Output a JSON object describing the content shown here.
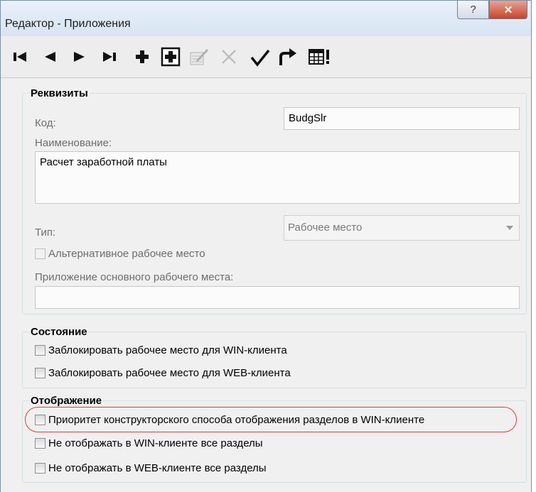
{
  "window": {
    "title": "Редактор - Приложения",
    "help_label": "?",
    "close_label": "✕"
  },
  "toolbar": {
    "items": [
      {
        "name": "first-record-icon",
        "glyph": "⏮"
      },
      {
        "name": "prev-record-icon",
        "glyph": "◀"
      },
      {
        "name": "next-record-icon",
        "glyph": "▶"
      },
      {
        "name": "last-record-icon",
        "glyph": "⏭"
      },
      {
        "name": "add-icon",
        "glyph": "✚"
      },
      {
        "name": "add-boxed-icon",
        "glyph": "⊞"
      },
      {
        "name": "edit-icon",
        "glyph": "✎"
      },
      {
        "name": "delete-icon",
        "glyph": "✕"
      },
      {
        "name": "confirm-icon",
        "glyph": "✓"
      },
      {
        "name": "refresh-icon",
        "glyph": "↪"
      },
      {
        "name": "grid-icon",
        "glyph": "▦!"
      }
    ]
  },
  "requisites": {
    "title": "Реквизиты",
    "code_label": "Код:",
    "code_value": "BudgSlr",
    "name_label": "Наименование:",
    "name_value": "Расчет заработной платы",
    "type_label": "Тип:",
    "type_value": "Рабочее место",
    "alt_workplace_label": "Альтернативное рабочее место",
    "main_app_label": "Приложение основного рабочего места:",
    "main_app_value": ""
  },
  "state": {
    "title": "Состояние",
    "lock_win_label": "Заблокировать рабочее место для WIN-клиента",
    "lock_web_label": "Заблокировать рабочее место для WEB-клиента"
  },
  "display": {
    "title": "Отображение",
    "priority_label": "Приоритет конструкторского способа отображения разделов в WIN-клиенте",
    "hide_win_label": "Не отображать в WIN-клиенте все разделы",
    "hide_web_label": "Не отображать в WEB-клиенте все разделы"
  },
  "colors": {
    "highlight": "#e23a3a",
    "close_button": "#c6442b"
  }
}
